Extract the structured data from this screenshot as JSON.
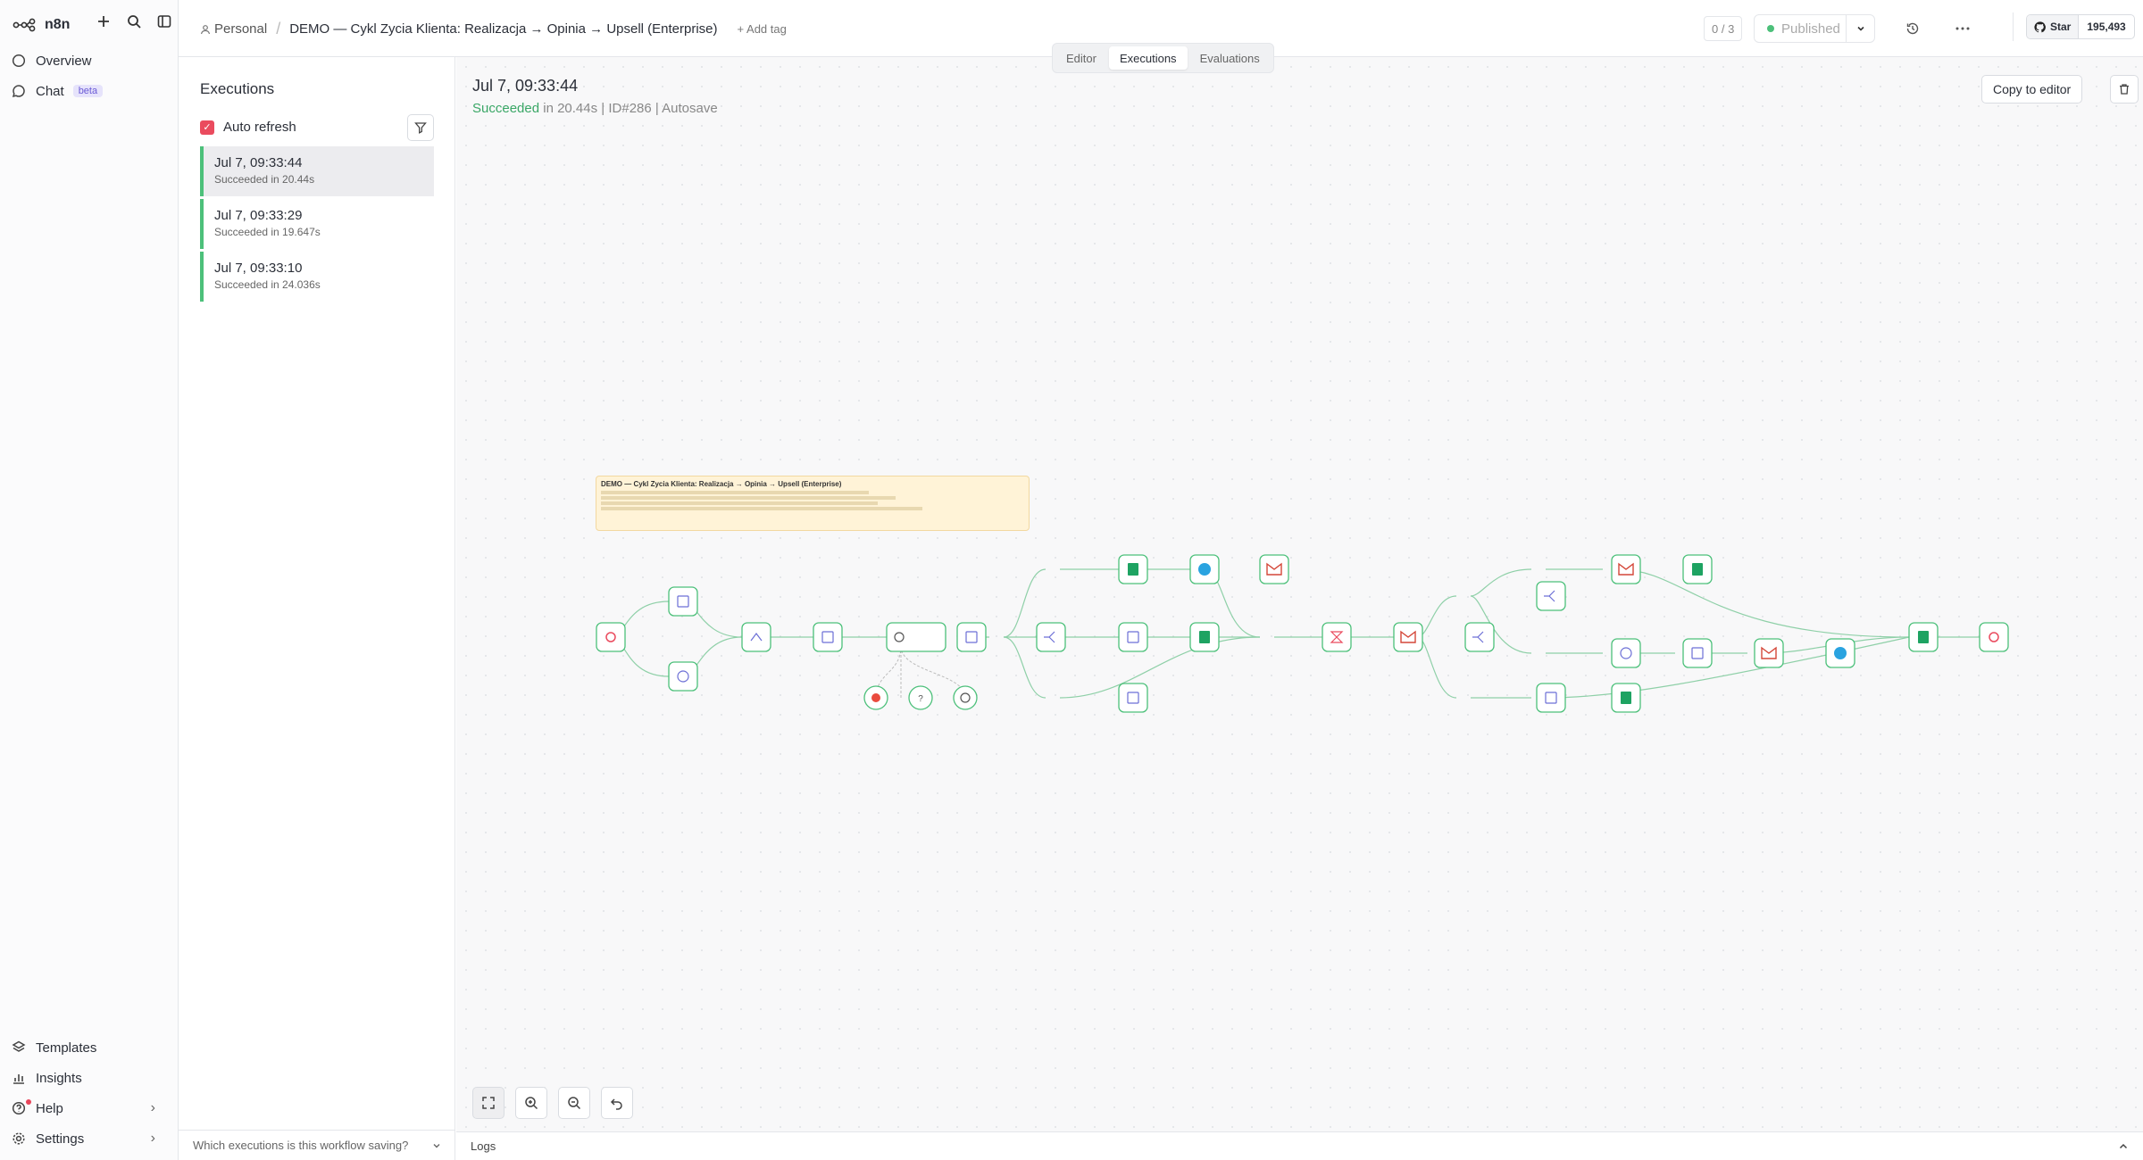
{
  "app": {
    "name": "n8n"
  },
  "sidebar": {
    "items": [
      {
        "label": "Overview"
      },
      {
        "label": "Chat",
        "badge": "beta"
      }
    ],
    "bottom": [
      {
        "label": "Templates"
      },
      {
        "label": "Insights"
      },
      {
        "label": "Help"
      },
      {
        "label": "Settings"
      }
    ]
  },
  "header": {
    "project": "Personal",
    "workflow_title": "DEMO — Cykl Zycia Klienta: Realizacja → Opinia → Upsell (Enterprise)",
    "add_tag": "+ Add tag",
    "counter": "0 / 3",
    "status": "Published",
    "github": {
      "star_label": "Star",
      "count": "195,493"
    }
  },
  "tabs": [
    {
      "label": "Editor"
    },
    {
      "label": "Executions"
    },
    {
      "label": "Evaluations"
    }
  ],
  "executions": {
    "title": "Executions",
    "auto_refresh": "Auto refresh",
    "items": [
      {
        "time": "Jul 7, 09:33:44",
        "status": "Succeeded in 20.44s"
      },
      {
        "time": "Jul 7, 09:33:29",
        "status": "Succeeded in 19.647s"
      },
      {
        "time": "Jul 7, 09:33:10",
        "status": "Succeeded in 24.036s"
      }
    ],
    "saving_question": "Which executions is this workflow saving?"
  },
  "detail": {
    "time": "Jul 7, 09:33:44",
    "status": "Succeeded",
    "duration": "in 20.44s",
    "id": "ID#286",
    "mode": "Autosave",
    "copy_button": "Copy to editor"
  },
  "sticky": {
    "title": "DEMO — Cykl Zycia Klienta: Realizacja → Opinia → Upsell (Enterprise)"
  },
  "logs": {
    "label": "Logs"
  },
  "colors": {
    "accent": "#ea4b5e",
    "success": "#3aa766",
    "edge": "#8fd0a8"
  }
}
